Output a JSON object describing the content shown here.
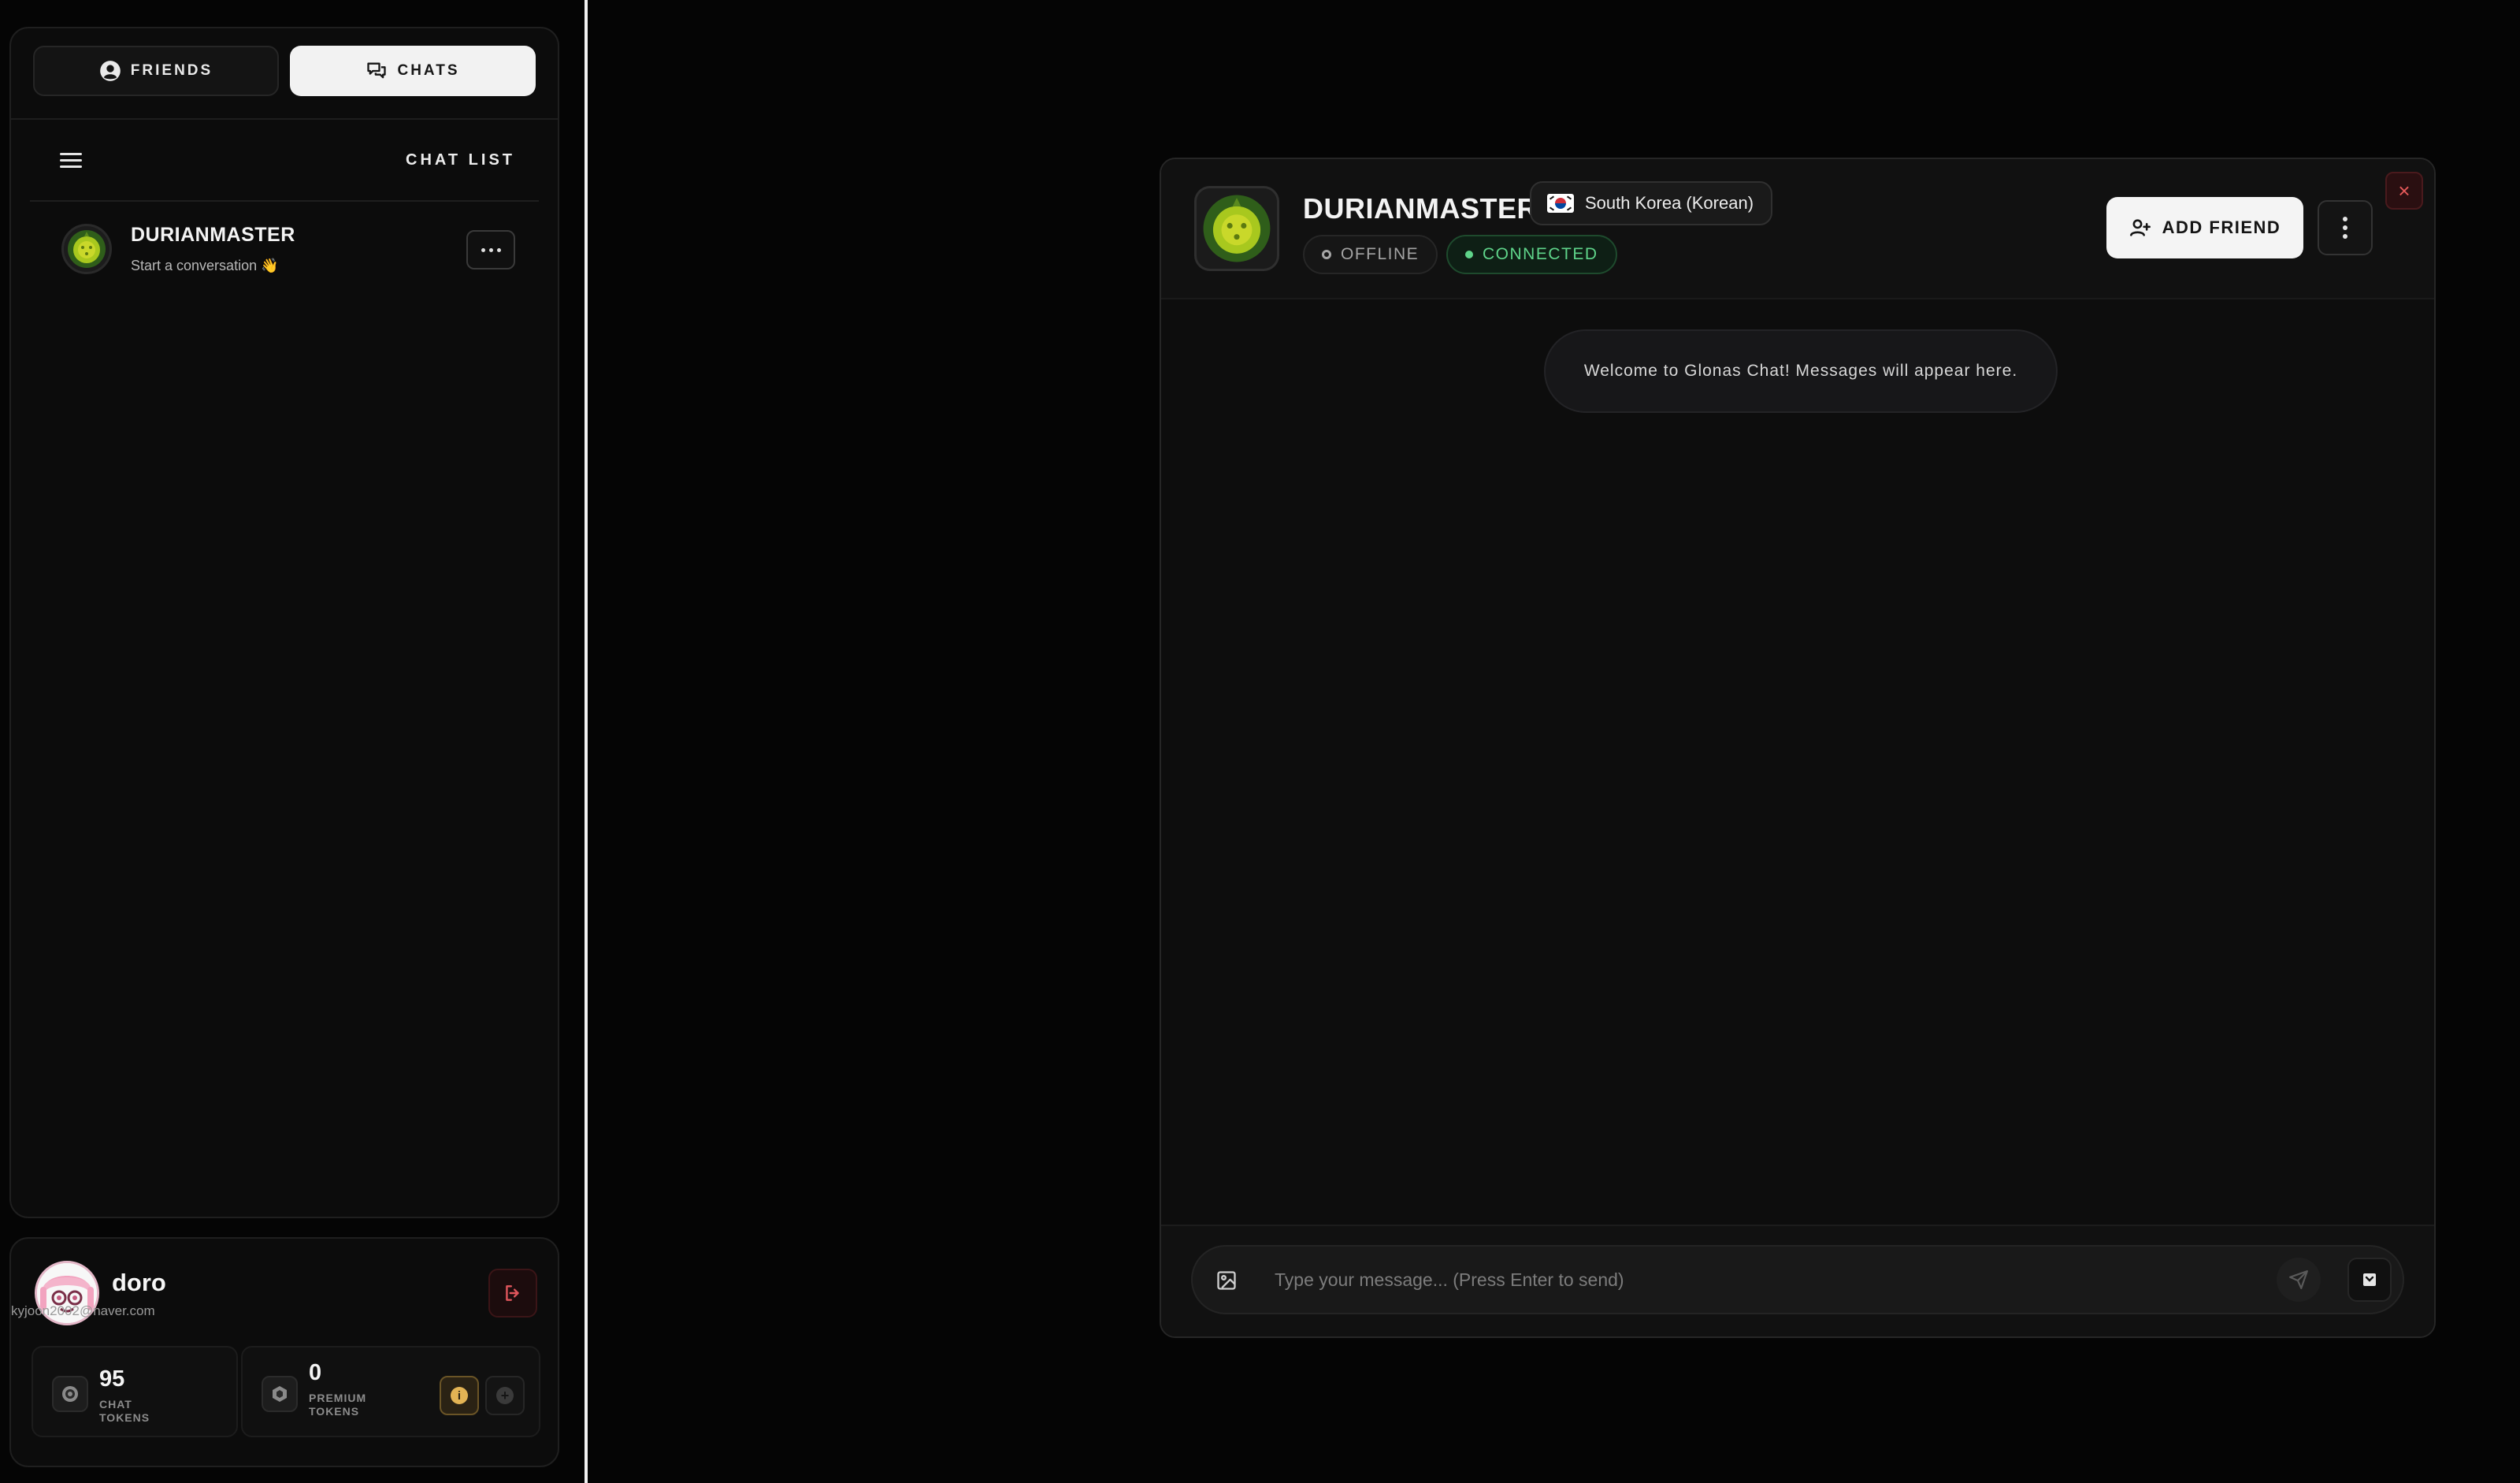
{
  "sidebar": {
    "tabs": [
      {
        "label": "FRIENDS",
        "icon": "user-circle-icon",
        "active": false
      },
      {
        "label": "CHATS",
        "icon": "chat-bubbles-icon",
        "active": true
      }
    ],
    "list_title": "CHAT LIST",
    "chats": [
      {
        "name": "DURIANMASTER",
        "preview": "Start a conversation 👋",
        "avatar": "durian-avatar"
      }
    ]
  },
  "user": {
    "name": "doro",
    "email": "kyjoon2002@naver.com",
    "tokens": {
      "chat_value": "95",
      "chat_label": "CHAT TOKENS",
      "premium_value": "0",
      "premium_label": "PREMIUM TOKENS",
      "info_glyph": "i",
      "add_glyph": "+"
    }
  },
  "chat_window": {
    "name": "DURIANMASTER",
    "country": "South Korea (Korean)",
    "status_offline": "OFFLINE",
    "status_connected": "CONNECTED",
    "add_friend_label": "ADD FRIEND",
    "close_glyph": "×",
    "system_message": "Welcome to Glonas Chat! Messages will appear here.",
    "input_placeholder": "Type your message... (Press Enter to send)"
  },
  "colors": {
    "background": "#050505",
    "panel": "#0c0c0c",
    "active_tab": "#f2f2f2",
    "connected_green": "#5fd48a",
    "close_red": "#e55a5a",
    "premium_gold": "#e2b354"
  }
}
